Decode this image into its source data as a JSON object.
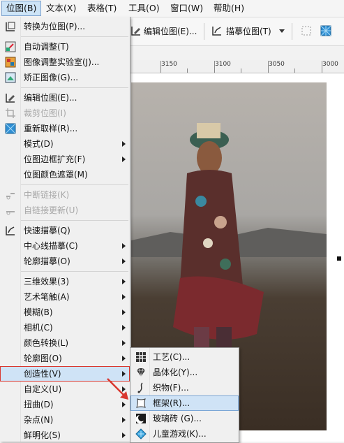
{
  "menubar": {
    "items": [
      "位图(B)",
      "文本(X)",
      "表格(T)",
      "工具(O)",
      "窗口(W)",
      "帮助(H)"
    ]
  },
  "toolbar": {
    "edit_bitmap": "编辑位图(E)...",
    "trace_bitmap": "描摹位图(T)"
  },
  "ruler": {
    "labels": [
      "3150",
      "3100",
      "3050",
      "3000"
    ]
  },
  "menu": {
    "items": [
      {
        "label": "转换为位图(P)...",
        "icon": "convert-bitmap-icon",
        "disabled": false,
        "submenu": false
      },
      {
        "label": "自动调整(T)",
        "icon": "auto-adjust-icon",
        "disabled": false,
        "submenu": false
      },
      {
        "label": "图像调整实验室(J)...",
        "icon": "image-adjust-lab-icon",
        "disabled": false,
        "submenu": false
      },
      {
        "label": "矫正图像(G)...",
        "icon": "straighten-image-icon",
        "disabled": false,
        "submenu": false
      },
      {
        "label": "编辑位图(E)...",
        "icon": "edit-bitmap-icon",
        "disabled": false,
        "submenu": false
      },
      {
        "label": "裁剪位图(I)",
        "icon": "crop-bitmap-icon",
        "disabled": true,
        "submenu": false
      },
      {
        "label": "重新取样(R)...",
        "icon": "resample-icon",
        "disabled": false,
        "submenu": false
      },
      {
        "label": "模式(D)",
        "icon": "",
        "disabled": false,
        "submenu": true
      },
      {
        "label": "位图边框扩充(F)",
        "icon": "",
        "disabled": false,
        "submenu": true
      },
      {
        "label": "位图颜色遮罩(M)",
        "icon": "",
        "disabled": false,
        "submenu": false
      },
      {
        "label": "中断链接(K)",
        "icon": "break-link-icon",
        "disabled": true,
        "submenu": false
      },
      {
        "label": "自链接更新(U)",
        "icon": "update-link-icon",
        "disabled": true,
        "submenu": false
      },
      {
        "label": "快速描摹(Q)",
        "icon": "quick-trace-icon",
        "disabled": false,
        "submenu": false
      },
      {
        "label": "中心线描摹(C)",
        "icon": "",
        "disabled": false,
        "submenu": true
      },
      {
        "label": "轮廓描摹(O)",
        "icon": "",
        "disabled": false,
        "submenu": true
      },
      {
        "label": "三维效果(3)",
        "icon": "",
        "disabled": false,
        "submenu": true
      },
      {
        "label": "艺术笔触(A)",
        "icon": "",
        "disabled": false,
        "submenu": true
      },
      {
        "label": "模糊(B)",
        "icon": "",
        "disabled": false,
        "submenu": true
      },
      {
        "label": "相机(C)",
        "icon": "",
        "disabled": false,
        "submenu": true
      },
      {
        "label": "颜色转换(L)",
        "icon": "",
        "disabled": false,
        "submenu": true
      },
      {
        "label": "轮廓图(O)",
        "icon": "",
        "disabled": false,
        "submenu": true
      },
      {
        "label": "创造性(V)",
        "icon": "",
        "disabled": false,
        "submenu": true
      },
      {
        "label": "自定义(U)",
        "icon": "",
        "disabled": false,
        "submenu": true
      },
      {
        "label": "扭曲(D)",
        "icon": "",
        "disabled": false,
        "submenu": true
      },
      {
        "label": "杂点(N)",
        "icon": "",
        "disabled": false,
        "submenu": true
      },
      {
        "label": "鲜明化(S)",
        "icon": "",
        "disabled": false,
        "submenu": true
      }
    ]
  },
  "submenu": {
    "items": [
      {
        "label": "工艺(C)...",
        "icon": "crafts-icon"
      },
      {
        "label": "晶体化(Y)...",
        "icon": "crystalize-icon"
      },
      {
        "label": "织物(F)...",
        "icon": "fabric-icon"
      },
      {
        "label": "框架(R)...",
        "icon": "frame-icon"
      },
      {
        "label": "玻璃砖 (G)...",
        "icon": "glass-block-icon"
      },
      {
        "label": "儿童游戏(K)...",
        "icon": "kids-play-icon"
      }
    ]
  },
  "colors": {
    "highlight": "#cfe3f6",
    "highlight_border": "#7aa6d6",
    "annotation_red": "#d9372f"
  }
}
